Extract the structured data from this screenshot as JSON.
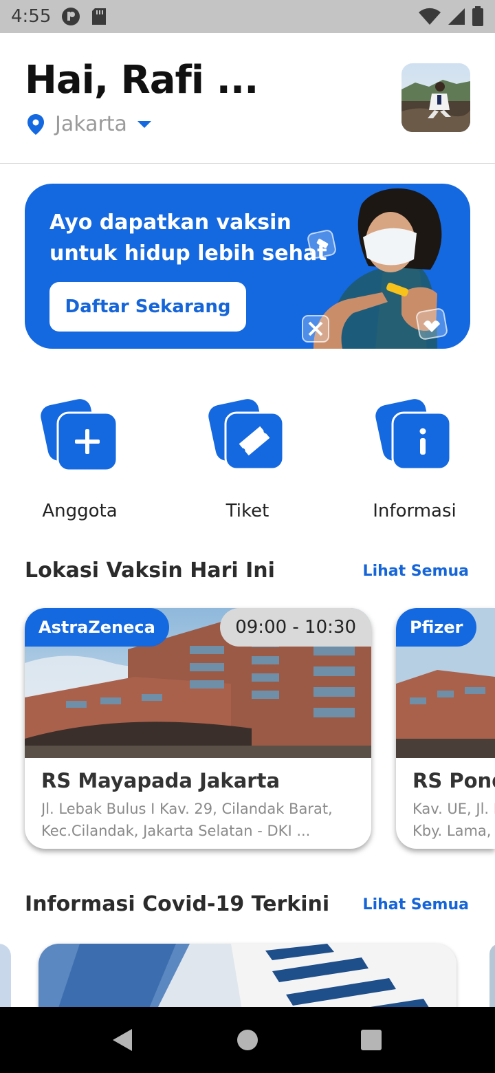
{
  "status_bar": {
    "time": "4:55"
  },
  "header": {
    "greeting": "Hai, Rafi ...",
    "location": "Jakarta"
  },
  "banner": {
    "title": "Ayo dapatkan vaksin untuk hidup lebih sehat",
    "button": "Daftar Sekarang"
  },
  "menu": {
    "items": [
      {
        "label": "Anggota",
        "icon": "plus-icon"
      },
      {
        "label": "Tiket",
        "icon": "ticket-icon"
      },
      {
        "label": "Informasi",
        "icon": "info-icon"
      }
    ]
  },
  "locations": {
    "title": "Lokasi Vaksin Hari Ini",
    "link": "Lihat Semua",
    "cards": [
      {
        "vaccine": "AstraZeneca",
        "time": "09:00 - 10:30",
        "name": "RS Mayapada Jakarta",
        "addr1": "Jl. Lebak Bulus I Kav. 29, Cilandak Barat,",
        "addr2": "Kec.Cilandak, Jakarta Selatan - DKI ..."
      },
      {
        "vaccine": "Pfizer",
        "name": "RS Pond",
        "addr1": "Kav. UE, Jl. N",
        "addr2": "Kby. Lama,"
      }
    ]
  },
  "news": {
    "title": "Informasi Covid-19 Terkini",
    "link": "Lihat Semua"
  },
  "colors": {
    "primary": "#1468e0",
    "link": "#1565d8"
  }
}
